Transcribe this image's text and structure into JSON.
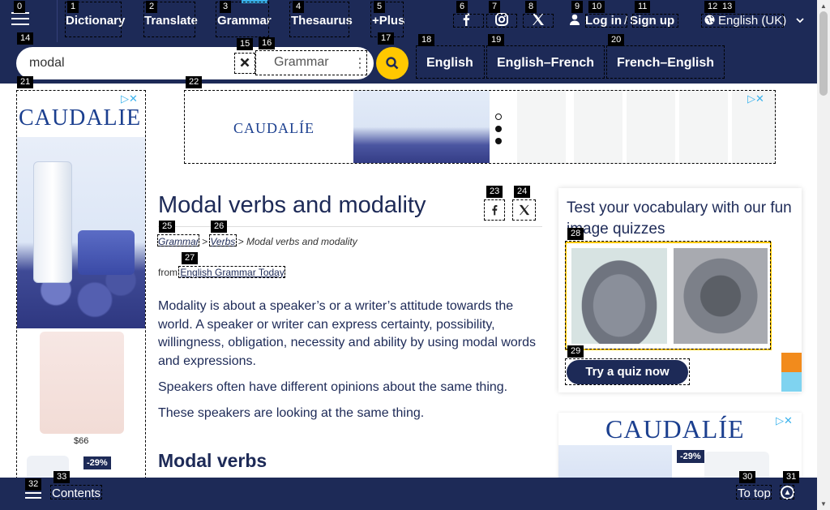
{
  "nav": {
    "items": [
      {
        "label": "Dictionary"
      },
      {
        "label": "Translate"
      },
      {
        "label": "Grammar"
      },
      {
        "label": "Thesaurus"
      },
      {
        "label": "+Plus"
      }
    ],
    "login": "Log in",
    "slash": "/",
    "signup": "Sign up",
    "language": "English (UK)"
  },
  "search": {
    "value": "modal",
    "dictionary": "Grammar",
    "tabs": [
      "English",
      "English–French",
      "French–English"
    ]
  },
  "ads": {
    "brand": "CAUDALIE",
    "brand_top": "CAUDALÍE",
    "price": "$66",
    "discount": "-29%"
  },
  "article": {
    "title": "Modal verbs and modality",
    "crumbs": [
      "Grammar",
      "Verbs",
      "Modal verbs and modality"
    ],
    "crumb_sep": ">",
    "from_label": "from",
    "source": "English Grammar Today",
    "paragraphs": [
      "Modality is about a speaker’s or a writer’s attitude towards the world. A speaker or writer can express certainty, possibility, willingness, obligation, necessity and ability by using modal words and expressions.",
      "Speakers often have different opinions about the same thing.",
      "These speakers are looking at the same thing."
    ],
    "subheading": "Modal verbs"
  },
  "quiz": {
    "title": "Test your vocabulary with our fun image quizzes",
    "button": "Try a quiz now"
  },
  "bottom": {
    "contents": "Contents",
    "to_top": "To top"
  },
  "tags": [
    "0",
    "1",
    "2",
    "3",
    "4",
    "5",
    "6",
    "7",
    "8",
    "9",
    "10",
    "11",
    "12",
    "13",
    "14",
    "15",
    "16",
    "17",
    "18",
    "19",
    "20",
    "21",
    "22",
    "23",
    "24",
    "25",
    "26",
    "27",
    "28",
    "29",
    "30",
    "31",
    "32",
    "33"
  ],
  "colors": {
    "navy": "#1d2a57",
    "accent": "#ffc800",
    "highlight": "#3ab2ec"
  }
}
